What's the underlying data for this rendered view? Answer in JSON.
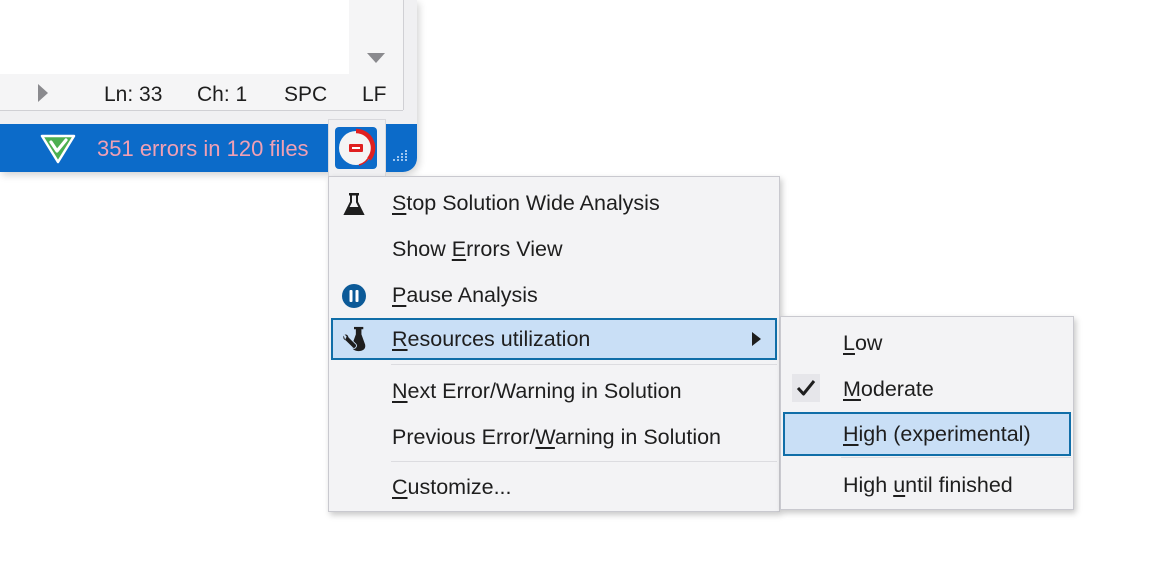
{
  "editor": {
    "status_fields": [
      {
        "name": "line",
        "text": "Ln: 33"
      },
      {
        "name": "char",
        "text": "Ch: 1"
      },
      {
        "name": "indent",
        "text": "SPC"
      },
      {
        "name": "line-ending",
        "text": "LF"
      }
    ]
  },
  "statusbar": {
    "errors_text": "351 errors in 120 files",
    "accent_color": "#0c6bc9",
    "errors_color": "#f0a0b4"
  },
  "context_menu": {
    "items": [
      {
        "id": "stop-analysis",
        "pre": "",
        "mnemonic": "S",
        "post": "top Solution Wide Analysis",
        "icon": "flask-icon"
      },
      {
        "id": "show-errors-view",
        "pre": "Show ",
        "mnemonic": "E",
        "post": "rrors View",
        "icon": ""
      },
      {
        "id": "pause-analysis",
        "pre": "",
        "mnemonic": "P",
        "post": "ause Analysis",
        "icon": "pause-icon"
      },
      {
        "id": "resources-utilization",
        "pre": "",
        "mnemonic": "R",
        "post": "esources utilization",
        "icon": "wrench-flask-icon",
        "has_submenu": true,
        "highlighted": true
      },
      {
        "id": "next-error",
        "pre": "",
        "mnemonic": "N",
        "post": "ext Error/Warning in Solution",
        "icon": ""
      },
      {
        "id": "previous-error",
        "pre": "Previous Error/",
        "mnemonic": "W",
        "post": "arning in Solution",
        "icon": ""
      },
      {
        "id": "customize",
        "pre": "",
        "mnemonic": "C",
        "post": "ustomize...",
        "icon": ""
      }
    ]
  },
  "submenu": {
    "items": [
      {
        "id": "low",
        "pre": "",
        "mnemonic": "L",
        "post": "ow",
        "checked": false
      },
      {
        "id": "moderate",
        "pre": "",
        "mnemonic": "M",
        "post": "oderate",
        "checked": true
      },
      {
        "id": "high-experimental",
        "pre": "",
        "mnemonic": "H",
        "post": "igh (experimental)",
        "checked": false,
        "highlighted": true
      },
      {
        "id": "high-until-finished",
        "pre": "High ",
        "mnemonic": "u",
        "post": "ntil finished",
        "checked": false
      }
    ]
  }
}
